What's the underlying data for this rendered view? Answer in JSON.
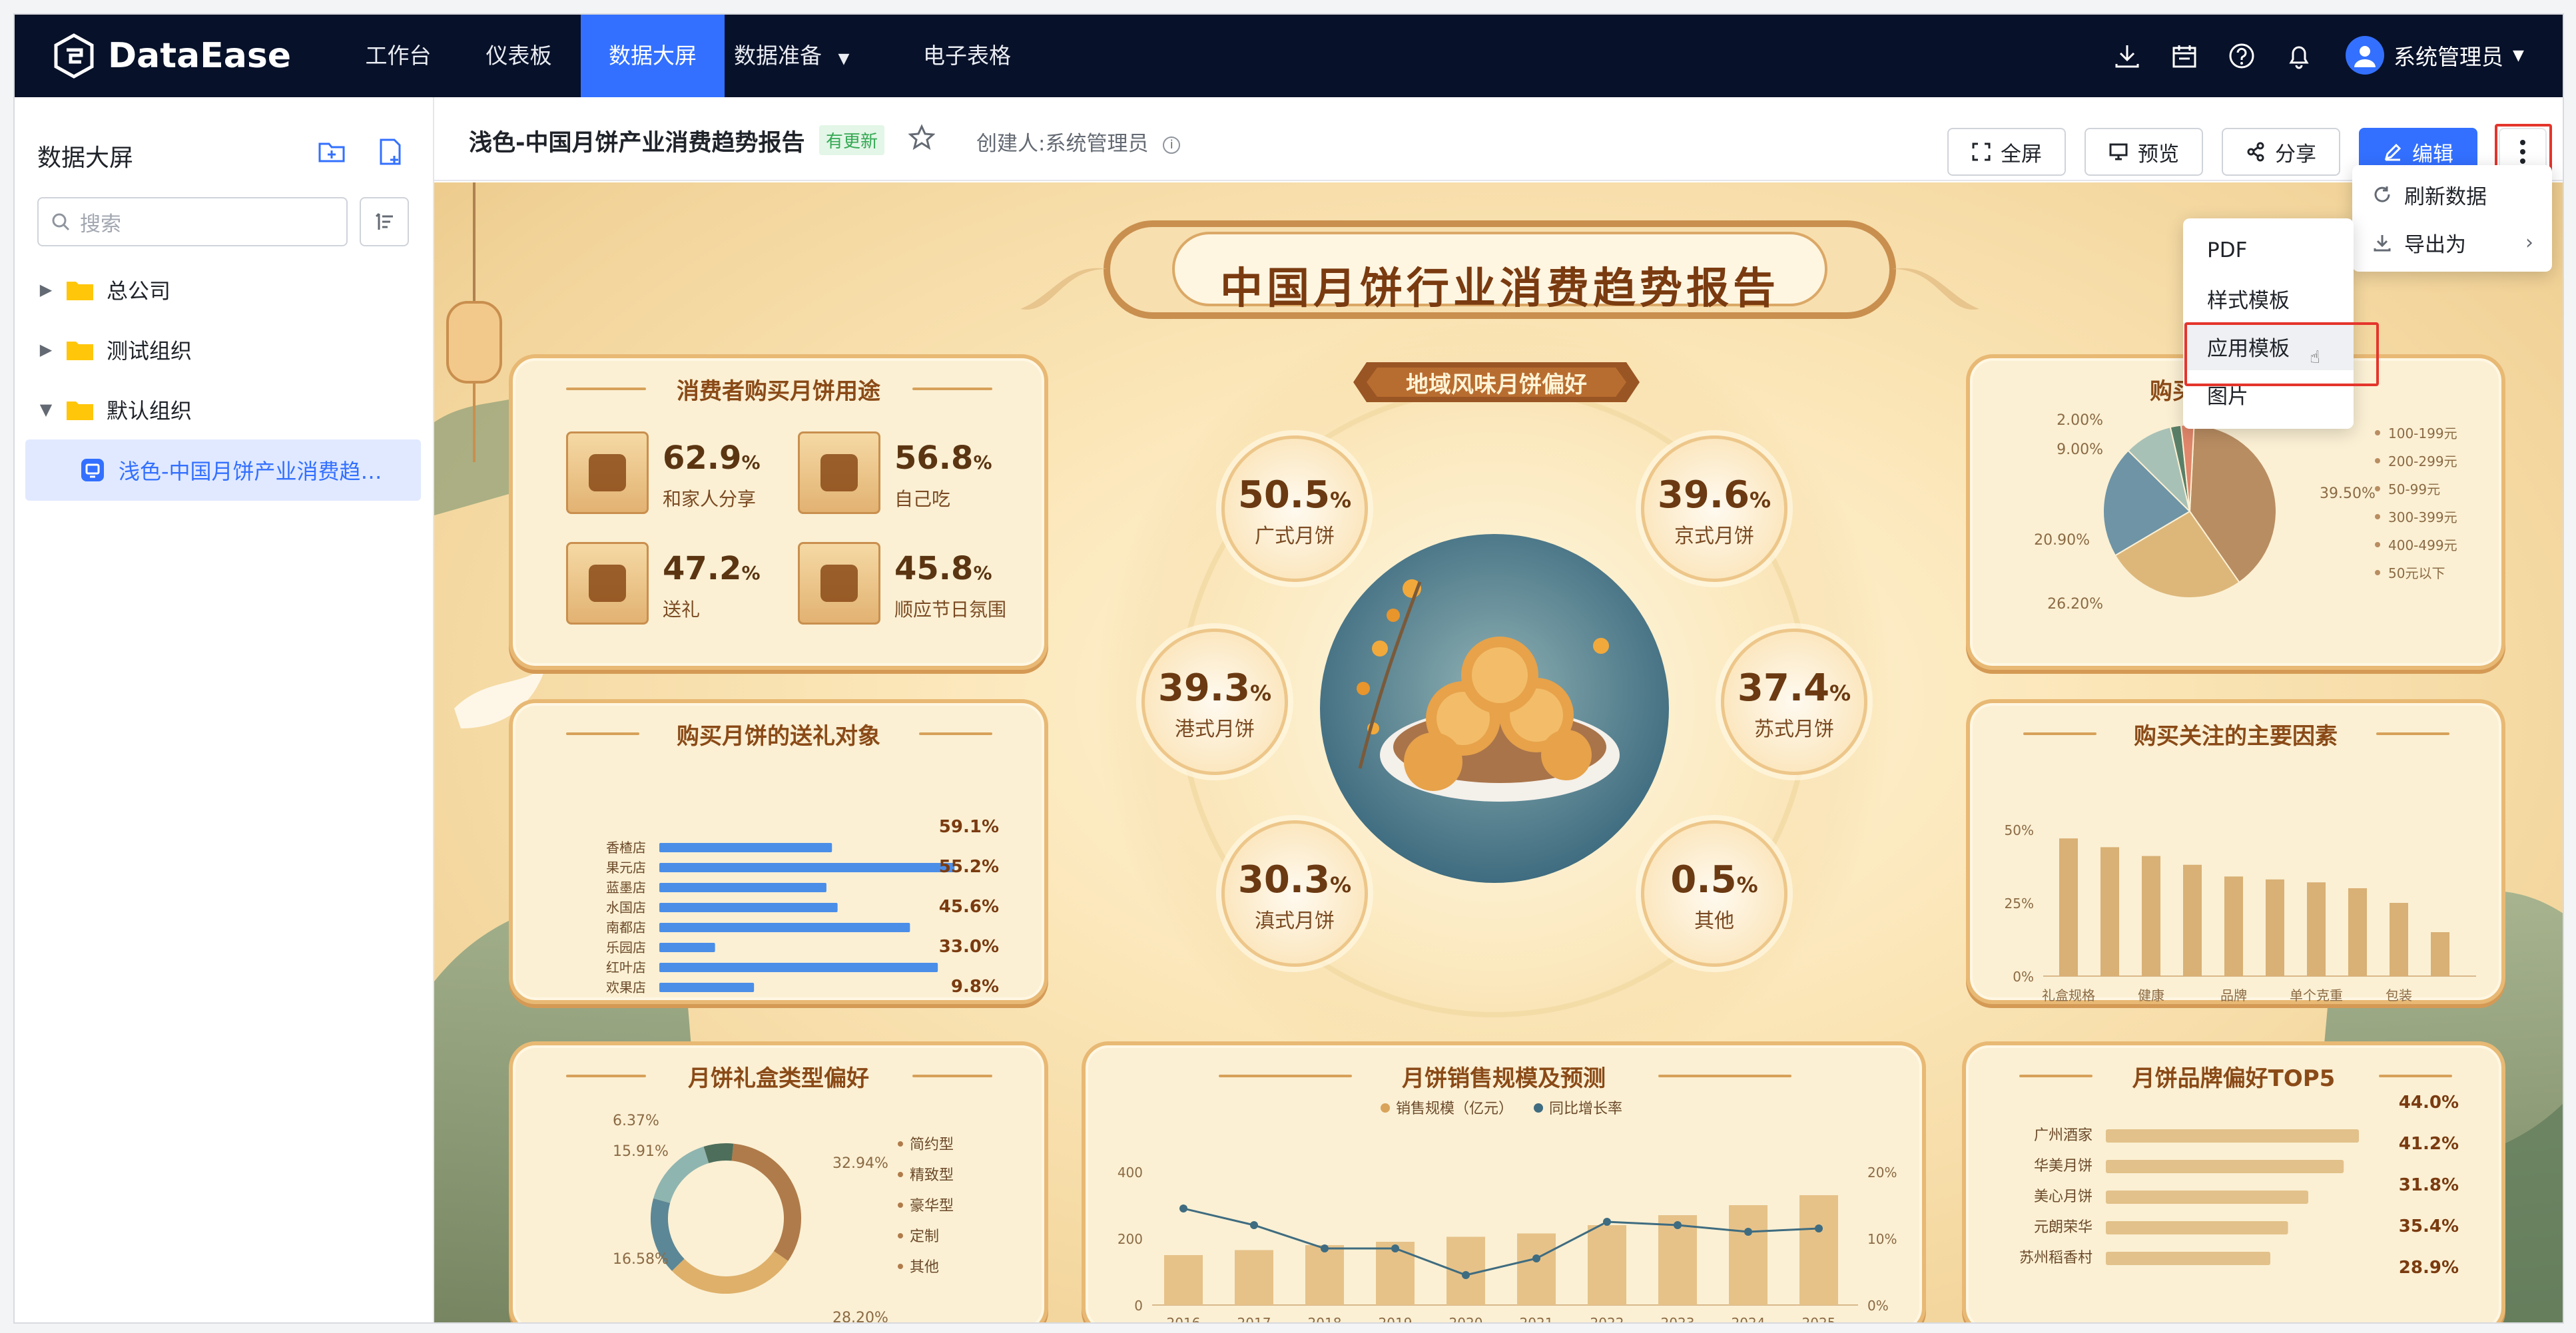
{
  "app": {
    "logo_text": "DataEase"
  },
  "nav": {
    "tabs": [
      "工作台",
      "仪表板",
      "数据大屏",
      "数据准备",
      "电子表格"
    ],
    "active": "数据大屏",
    "user": "系统管理员"
  },
  "sidebar": {
    "title": "数据大屏",
    "search_placeholder": "搜索",
    "tree": [
      {
        "label": "总公司",
        "expanded": false
      },
      {
        "label": "测试组织",
        "expanded": false
      },
      {
        "label": "默认组织",
        "expanded": true
      },
      {
        "label": "浅色-中国月饼产业消费趋…",
        "selected": true
      }
    ]
  },
  "header": {
    "title": "浅色-中国月饼产业消费趋势报告",
    "badge": "有更新",
    "creator": "创建人:系统管理员",
    "buttons": {
      "fullscreen": "全屏",
      "preview": "预览",
      "share": "分享",
      "edit": "编辑"
    }
  },
  "more_menu": {
    "refresh": "刷新数据",
    "export": "导出为"
  },
  "export_menu": {
    "items": [
      "PDF",
      "样式模板",
      "应用模板",
      "图片"
    ],
    "hovered": "应用模板"
  },
  "screen": {
    "main_title": "中国月饼行业消费趋势报告",
    "center_title": "地域风味月饼偏好",
    "regions": [
      {
        "value": "50.5",
        "unit": "%",
        "label": "广式月饼"
      },
      {
        "value": "39.6",
        "unit": "%",
        "label": "京式月饼"
      },
      {
        "value": "39.3",
        "unit": "%",
        "label": "港式月饼"
      },
      {
        "value": "37.4",
        "unit": "%",
        "label": "苏式月饼"
      },
      {
        "value": "30.3",
        "unit": "%",
        "label": "滇式月饼"
      },
      {
        "value": "0.5",
        "unit": "%",
        "label": "其他"
      }
    ],
    "usage": {
      "title": "消费者购买月饼用途",
      "items": [
        {
          "value": "62.9",
          "unit": "%",
          "label": "和家人分享"
        },
        {
          "value": "56.8",
          "unit": "%",
          "label": "自己吃"
        },
        {
          "value": "47.2",
          "unit": "%",
          "label": "送礼"
        },
        {
          "value": "45.8",
          "unit": "%",
          "label": "顺应节日氛围"
        }
      ]
    },
    "price": {
      "title_visible": "购买",
      "slice_labels": [
        "2.00%",
        "9.00%",
        "20.90%",
        "26.20%",
        "39.50%"
      ],
      "legend": [
        "100-199元",
        "200-299元",
        "50-99元",
        "300-399元",
        "400-499元",
        "50元以下"
      ]
    },
    "gift": {
      "title": "购买月饼的送礼对象",
      "stores": [
        "香楂店",
        "果元店",
        "蓝墨店",
        "水国店",
        "南都店",
        "乐园店",
        "红叶店",
        "欢果店"
      ],
      "pct_labels": [
        "59.1%",
        "55.2%",
        "45.6%",
        "33.0%",
        "9.8%"
      ]
    },
    "factors": {
      "title": "购买关注的主要因素",
      "yticks": [
        "50%",
        "25%",
        "0%"
      ],
      "xlabels": [
        "礼盒规格",
        "健康",
        "品牌",
        "单个克重",
        "包装"
      ]
    },
    "giftbox": {
      "title": "月饼礼盒类型偏好",
      "labels": [
        "6.37%",
        "15.91%",
        "16.58%",
        "32.94%",
        "28.20%"
      ],
      "legend": [
        "简约型",
        "精致型",
        "豪华型",
        "定制",
        "其他"
      ]
    },
    "sales": {
      "title": "月饼销售规模及预测",
      "legend": [
        "销售规模（亿元）",
        "同比增长率"
      ],
      "yleft": [
        "400",
        "200",
        "0"
      ],
      "yright": [
        "20%",
        "10%",
        "0%"
      ]
    },
    "brands": {
      "title": "月饼品牌偏好TOP5",
      "items": [
        {
          "label": "广州酒家",
          "pct": "44.0%"
        },
        {
          "label": "华美月饼",
          "pct": "41.2%"
        },
        {
          "label": "美心月饼",
          "pct": "31.8%"
        },
        {
          "label": "元朗荣华",
          "pct": "35.4%"
        },
        {
          "label": "苏州稻香村",
          "pct": "28.9%"
        }
      ]
    }
  },
  "chart_data": [
    {
      "type": "pie",
      "title": "",
      "categories": [
        "100-199元",
        "200-299元",
        "50-99元",
        "300-399元",
        "400-499元",
        "50元以下"
      ],
      "values": [
        39.5,
        26.2,
        20.9,
        9.0,
        2.0,
        2.4
      ],
      "legend": "right"
    },
    {
      "type": "bar",
      "title": "购买月饼的送礼对象",
      "categories": [
        "香楂店",
        "果元店",
        "蓝墨店",
        "水国店",
        "南都店",
        "乐园店",
        "红叶店",
        "欢果店"
      ],
      "values": [
        31,
        53,
        30,
        32,
        45,
        10,
        50,
        17
      ],
      "orientation": "horizontal"
    },
    {
      "type": "bar",
      "title": "购买关注的主要因素",
      "categories": [
        "礼盒规格",
        "",
        "健康",
        "",
        "品牌",
        "",
        "单个克重",
        "",
        "包装",
        ""
      ],
      "values": [
        47,
        44,
        41,
        38,
        34,
        33,
        32,
        30,
        25,
        15
      ],
      "ylim": [
        0,
        50
      ]
    },
    {
      "type": "pie",
      "title": "月饼礼盒类型偏好",
      "categories": [
        "简约型",
        "精致型",
        "豪华型",
        "定制",
        "其他"
      ],
      "values": [
        32.94,
        28.2,
        16.58,
        15.91,
        6.37
      ],
      "donut": true,
      "legend": "right"
    },
    {
      "type": "bar",
      "title": "月饼销售规模及预测",
      "x": [
        "2016",
        "2017",
        "2018",
        "2019",
        "2020",
        "2021",
        "2022",
        "2023",
        "2024",
        "2025"
      ],
      "series": [
        {
          "name": "销售规模（亿元）",
          "values": [
            150,
            165,
            180,
            190,
            205,
            215,
            240,
            270,
            300,
            330
          ]
        },
        {
          "name": "同比增长率",
          "values": [
            14.5,
            12.0,
            8.5,
            8.5,
            4.5,
            7.0,
            12.5,
            12.0,
            11.0,
            11.5
          ],
          "type": "line",
          "axis": "right"
        }
      ],
      "ylim": [
        0,
        400
      ],
      "y2lim": [
        0,
        20
      ]
    },
    {
      "type": "bar",
      "title": "月饼品牌偏好TOP5",
      "categories": [
        "广州酒家",
        "华美月饼",
        "美心月饼",
        "元朗荣华",
        "苏州稻香村"
      ],
      "values": [
        44.0,
        41.2,
        31.8,
        35.4,
        28.9
      ],
      "orientation": "horizontal"
    }
  ]
}
